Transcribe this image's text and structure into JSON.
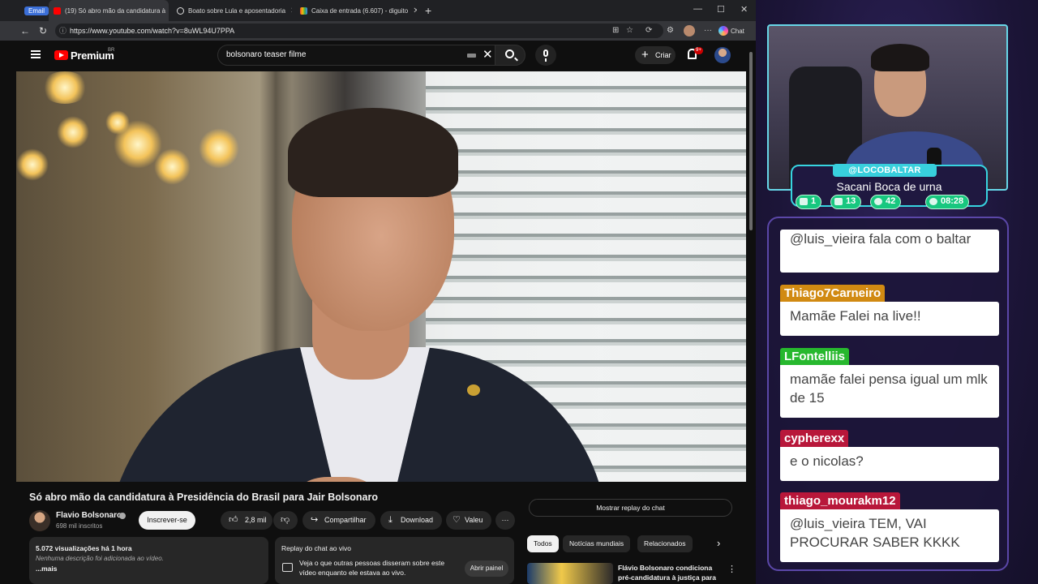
{
  "browser": {
    "email_chip": "Email",
    "tabs": [
      {
        "label": "(19) Só abro mão da candidatura à"
      },
      {
        "label": "Boato sobre Lula e aposentadoria"
      },
      {
        "label": "Caixa de entrada (6.607) - diguito"
      }
    ],
    "new_tab": "+",
    "url": "https://www.youtube.com/watch?v=8uWL94U7PPA",
    "chat_label": "Chat",
    "window_controls": {
      "minimize": "—",
      "maximize": "☐",
      "close": "✕"
    }
  },
  "youtube": {
    "brand": "Premium",
    "region": "BR",
    "search_query": "bolsonaro teaser filme",
    "create_label": "Criar",
    "notifications_badge": "9+",
    "video_title": "Só abro mão da candidatura à Presidência do Brasil para Jair Bolsonaro",
    "channel": {
      "name": "Flavio Bolsonaro",
      "subscribers": "698 mil inscritos"
    },
    "subscribe_label": "Inscrever-se",
    "likes": "2,8 mil",
    "share_label": "Compartilhar",
    "download_label": "Download",
    "thanks_label": "Valeu",
    "more_label": "···",
    "description": {
      "views": "5.072 visualizações  há 1 hora",
      "empty": "Nenhuma descrição foi adicionada ao vídeo.",
      "more": "...mais"
    },
    "chat_replay": {
      "title": "Replay do chat ao vivo",
      "desc": "Veja o que outras pessoas disseram sobre este vídeo enquanto ele estava ao vivo.",
      "open_panel": "Abrir painel"
    },
    "show_chat_replay": "Mostrar replay do chat",
    "chips": [
      "Todos",
      "Notícias mundiais",
      "Relacionados"
    ],
    "recommended": {
      "title": "Flávio Bolsonaro condiciona pré-candidatura à justiça para ..."
    }
  },
  "overlay": {
    "handle": "@LOCOBALTAR",
    "stream_title": "Sacani Boca de urna",
    "stats": [
      {
        "icon": "chat-icon",
        "value": "1"
      },
      {
        "icon": "youtube-icon",
        "value": "13"
      },
      {
        "icon": "viewers-icon",
        "value": "42"
      },
      {
        "icon": "clock-icon",
        "value": "08:28"
      }
    ],
    "chat": [
      {
        "user": "",
        "text": "@luis_vieira fala com o baltar",
        "color": ""
      },
      {
        "user": "Thiago7Carneiro",
        "text": "Mamãe Falei na live!!",
        "color": "#d18a12"
      },
      {
        "user": "LFontelliis",
        "text": "mamãe falei pensa igual um mlk de 15",
        "color": "#27b82e"
      },
      {
        "user": "cypherexx",
        "text": "e o nicolas?",
        "color": "#b8173a"
      },
      {
        "user": "thiago_mourakm12",
        "text": "@luis_vieira TEM, VAI PROCURAR SABER KKKK",
        "color": "#b8173a"
      }
    ]
  }
}
